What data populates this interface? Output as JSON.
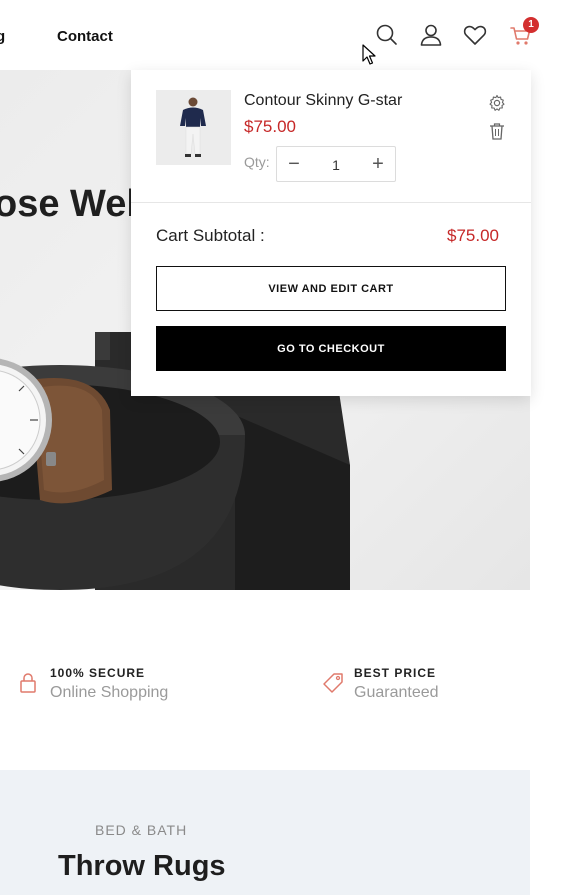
{
  "nav": {
    "partial_item": "g",
    "contact": "Contact"
  },
  "header_icons": [
    "search-icon",
    "user-icon",
    "heart-icon",
    "cart-icon"
  ],
  "cart": {
    "badge_count": "1",
    "items": [
      {
        "name": "Contour Skinny G-star",
        "price": "$75.00",
        "qty_label": "Qty:",
        "qty": "1"
      }
    ],
    "subtotal_label": "Cart Subtotal :",
    "subtotal_value": "$75.00",
    "view_edit_label": "VIEW AND EDIT CART",
    "checkout_label": "GO TO CHECKOUT"
  },
  "hero": {
    "title_fragment": "ose Well"
  },
  "features": [
    {
      "title": "100% SECURE",
      "subtitle": "Online Shopping",
      "icon": "lock-icon"
    },
    {
      "title": "BEST PRICE",
      "subtitle": "Guaranteed",
      "icon": "price-tag-icon"
    }
  ],
  "category_section": {
    "category": "BED & BATH",
    "title": "Throw Rugs"
  },
  "colors": {
    "accent_red": "#c62828",
    "badge_red": "#d32f2f",
    "feature_icon": "#e07a6c",
    "section_bg": "#eef2f6"
  }
}
